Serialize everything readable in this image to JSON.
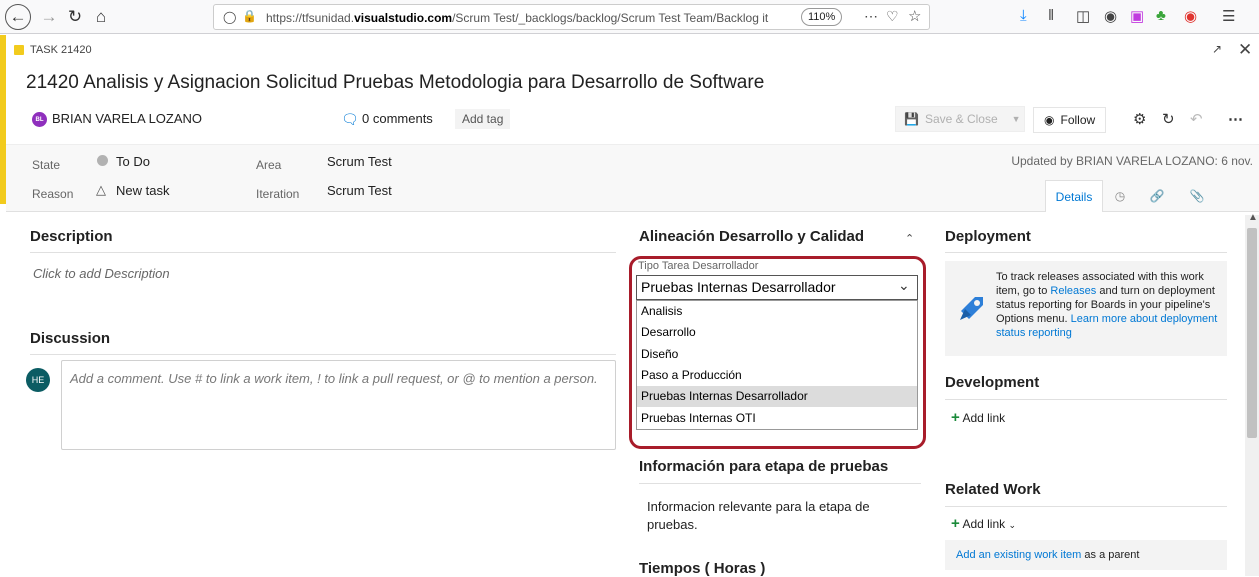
{
  "browser": {
    "url_prefix": "https://tfsunidad.",
    "url_domain": "visualstudio.com",
    "url_path": "/Scrum Test/_backlogs/backlog/Scrum Test Team/Backlog it",
    "zoom": "110%",
    "more": "⋯"
  },
  "work_item": {
    "type_label": "TASK 21420",
    "title": "21420  Analisis y Asignacion Solicitud Pruebas Metodologia para Desarrollo de Software",
    "assignee_initials": "BL",
    "assignee": "BRIAN VARELA LOZANO",
    "comments": "0 comments",
    "add_tag": "Add tag",
    "save_close": "Save & Close",
    "follow": "Follow",
    "state_label": "State",
    "state_value": "To Do",
    "reason_label": "Reason",
    "reason_value": "New task",
    "area_label": "Area",
    "area_value": "Scrum Test",
    "iteration_label": "Iteration",
    "iteration_value": "Scrum Test",
    "updated": "Updated by BRIAN VARELA LOZANO: 6 nov.",
    "tab_details": "Details"
  },
  "left": {
    "description_heading": "Description",
    "description_placeholder": "Click to add Description",
    "discussion_heading": "Discussion",
    "commenter_initials": "HE",
    "comment_placeholder": "Add a comment. Use # to link a work item, ! to link a pull request, or @ to mention a person."
  },
  "middle": {
    "alignment_heading": "Alineación Desarrollo y Calidad",
    "field_label": "Tipo Tarea Desarrollador",
    "field_value": "Pruebas Internas Desarrollador",
    "options": [
      "Analisis",
      "Desarrollo",
      "Diseño",
      "Paso a Producción",
      "Pruebas Internas Desarrollador",
      "Pruebas Internas OTI"
    ],
    "selected_index": 4,
    "testing_heading": "Información para etapa de pruebas",
    "testing_text": "Informacion relevante para la etapa de pruebas.",
    "times_heading": "Tiempos ( Horas )"
  },
  "right": {
    "deployment_heading": "Deployment",
    "deploy_text_1": "To track releases associated with this work item, go to ",
    "deploy_link_1": "Releases",
    "deploy_text_2": " and turn on deployment status reporting for Boards in your pipeline's Options menu. ",
    "deploy_link_2": "Learn more about deployment status reporting",
    "development_heading": "Development",
    "dev_add_link": "Add link",
    "related_heading": "Related Work",
    "related_add_link": "Add link",
    "related_link": "Add an existing work item",
    "related_suffix": " as a parent"
  },
  "colors": {
    "accent": "#f2cb1d",
    "link": "#0078d4",
    "highlight_border": "#a81c2a"
  }
}
